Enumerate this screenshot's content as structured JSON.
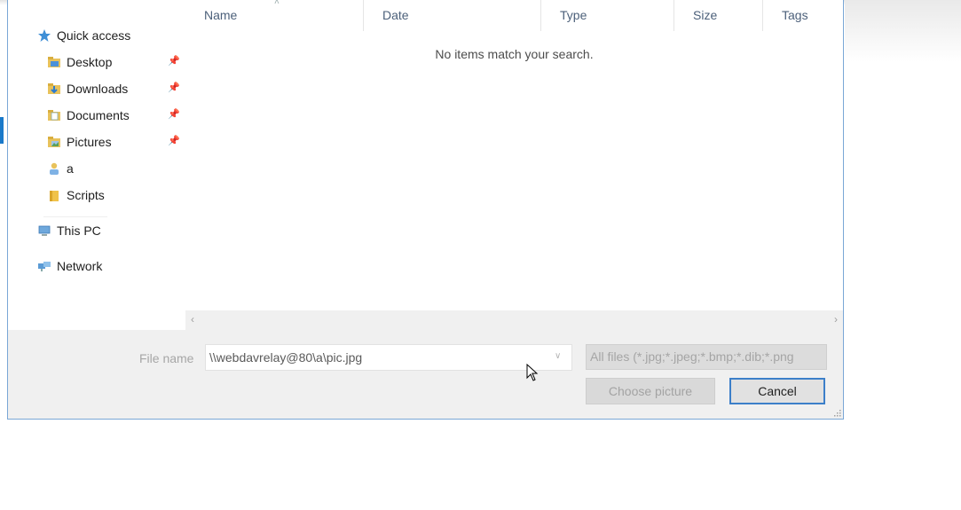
{
  "columns": [
    "Name",
    "Date",
    "Type",
    "Size",
    "Tags"
  ],
  "empty_message": "No items match your search.",
  "nav": {
    "quick_access": "Quick access",
    "items": [
      {
        "label": "Desktop",
        "icon": "desktop-folder-icon",
        "pinned": true
      },
      {
        "label": "Downloads",
        "icon": "downloads-folder-icon",
        "pinned": true
      },
      {
        "label": "Documents",
        "icon": "documents-folder-icon",
        "pinned": true
      },
      {
        "label": "Pictures",
        "icon": "pictures-folder-icon",
        "pinned": true
      },
      {
        "label": "a",
        "icon": "user-folder-icon",
        "pinned": false
      },
      {
        "label": "Scripts",
        "icon": "folder-icon",
        "pinned": false
      }
    ],
    "this_pc": "This PC",
    "network": "Network"
  },
  "file_name": {
    "label": "File name",
    "value": "\\\\webdavrelay@80\\a\\pic.jpg"
  },
  "filter": "All files (*.jpg;*.jpeg;*.bmp;*.dib;*.png",
  "buttons": {
    "choose": "Choose picture",
    "cancel": "Cancel"
  },
  "colors": {
    "accent": "#1979ca",
    "dialog_border": "#7aa7d6",
    "cancel_border": "#3c7fc9",
    "folder": "#e8c25b"
  }
}
